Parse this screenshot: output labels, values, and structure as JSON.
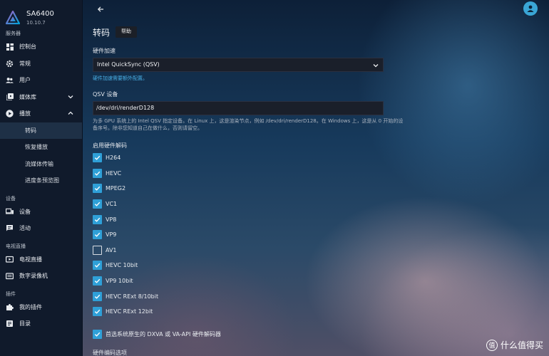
{
  "app": {
    "server_name": "SA6400",
    "version": "10.10.7"
  },
  "sidebar": {
    "sections": {
      "server": "服务器",
      "devices": "设备",
      "livetv": "电视直播",
      "plugins": "插件"
    },
    "items": {
      "dashboard": "控制台",
      "general": "常规",
      "users": "用户",
      "libraries": "媒体库",
      "playback": "播放",
      "devices": "设备",
      "activity": "活动",
      "livetv": "电视直播",
      "dvr": "数字录像机",
      "my_plugins": "我的插件",
      "catalog": "目录"
    },
    "playback_sub": {
      "transcoding": "转码",
      "resume": "恢复播放",
      "streaming": "流媒体传输",
      "trickplay": "进度条预览图"
    }
  },
  "page": {
    "title": "转码",
    "help_label": "帮助",
    "hw_accel_label": "硬件加速",
    "hw_accel_value": "Intel QuickSync (QSV)",
    "hw_accel_note": "硬件加速需要额外配置。",
    "qsv_device_label": "QSV 设备",
    "qsv_device_value": "/dev/dri/renderD128",
    "qsv_device_help": "为多 GPU 系统上的 Intel QSV 指定设备。在 Linux 上，这是渲染节点，例如 /dev/dri/renderD128。在 Windows 上，这是从 0 开始的设备序号。除非您知道自己在做什么，否则请留空。",
    "hw_decode_heading": "启用硬件解码",
    "codecs": [
      {
        "label": "H264",
        "checked": true
      },
      {
        "label": "HEVC",
        "checked": true
      },
      {
        "label": "MPEG2",
        "checked": true
      },
      {
        "label": "VC1",
        "checked": true
      },
      {
        "label": "VP8",
        "checked": true
      },
      {
        "label": "VP9",
        "checked": true
      },
      {
        "label": "AV1",
        "checked": false
      },
      {
        "label": "HEVC 10bit",
        "checked": true
      },
      {
        "label": "VP9 10bit",
        "checked": true
      },
      {
        "label": "HEVC RExt 8/10bit",
        "checked": true
      },
      {
        "label": "HEVC RExt 12bit",
        "checked": true
      }
    ],
    "prefer_native_label": "首选系统原生的 DXVA 或 VA-API 硬件解码器",
    "prefer_native_checked": true,
    "hw_encode_heading": "硬件编码选项"
  },
  "watermark": {
    "text": "什么值得买",
    "glyph": "值"
  },
  "colors": {
    "accent": "#2fa0d8",
    "link": "#48aee4",
    "sidebar_bg": "#101a2b"
  },
  "icons": {
    "back": "back-arrow-icon",
    "avatar": "user-avatar-icon"
  }
}
